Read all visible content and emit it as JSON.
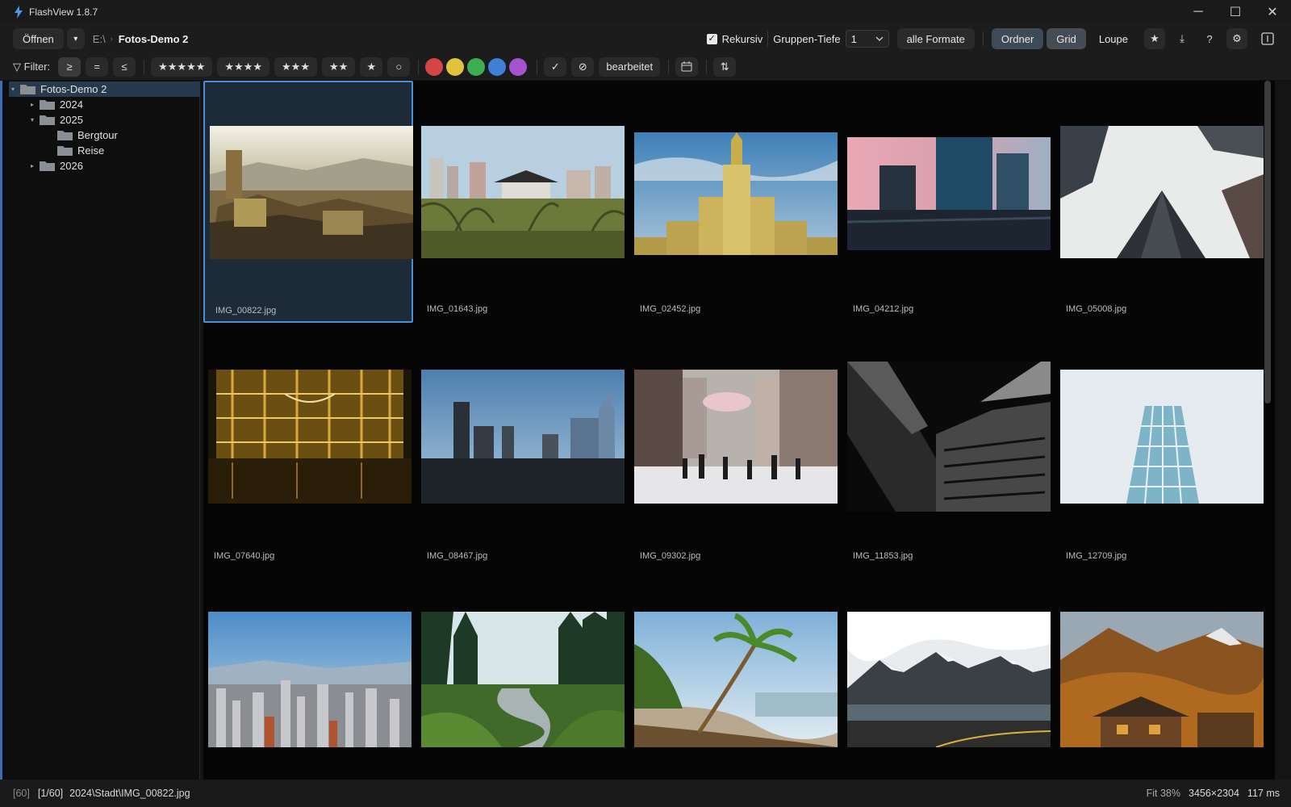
{
  "window": {
    "title": "FlashView 1.8.7",
    "controls": [
      "─",
      "☐",
      "✕"
    ]
  },
  "toolbar": {
    "open_label": "Öffnen",
    "open_dropdown": "▾",
    "path_root": "E:\\",
    "path_current": "Fotos-Demo 2",
    "recursive_label": "Rekursiv",
    "recursive_checked": "✓",
    "group_depth_label": "Gruppen-Tiefe",
    "group_depth_value": "1",
    "formats_label": "alle Formate",
    "view_modes": [
      "Ordner",
      "Grid",
      "Loupe"
    ],
    "active_view": "Grid",
    "icon_buttons": [
      {
        "name": "favorite-star-icon",
        "glyph": "★"
      },
      {
        "name": "download-icon",
        "glyph": "⤓"
      },
      {
        "name": "help-icon",
        "glyph": "?"
      },
      {
        "name": "gear-icon",
        "glyph": "⚙"
      },
      {
        "name": "info-panel-icon",
        "glyph": "▯"
      }
    ]
  },
  "filter": {
    "label": "Filter:",
    "label_icon": "▽",
    "comparators": [
      "≥",
      "=",
      "≤"
    ],
    "active_comparator": "≥",
    "ratings": [
      "★★★★★",
      "★★★★",
      "★★★",
      "★★",
      "★",
      "○"
    ],
    "colors": [
      {
        "name": "red",
        "hex": "#d64545"
      },
      {
        "name": "yellow",
        "hex": "#e0c23c"
      },
      {
        "name": "green",
        "hex": "#3fae52"
      },
      {
        "name": "blue",
        "hex": "#3f7fd6"
      },
      {
        "name": "purple",
        "hex": "#a552cf"
      }
    ],
    "flag_check": "✓",
    "flag_reject": "⊘",
    "edited_label": "bearbeitet",
    "calendar_icon": "▦",
    "sort_icon": "⇅"
  },
  "tree": [
    {
      "label": "Fotos-Demo 2",
      "level": 0,
      "expander": "▾",
      "selected": true
    },
    {
      "label": "2024",
      "level": 1,
      "expander": "▸"
    },
    {
      "label": "2025",
      "level": 1,
      "expander": "▾"
    },
    {
      "label": "Bergtour",
      "level": 2,
      "expander": ""
    },
    {
      "label": "Reise",
      "level": 2,
      "expander": ""
    },
    {
      "label": "2026",
      "level": 1,
      "expander": "▸"
    }
  ],
  "images": [
    {
      "file": "IMG_00822.jpg",
      "kind": "village",
      "selected": true
    },
    {
      "file": "IMG_01643.jpg",
      "kind": "pagoda"
    },
    {
      "file": "IMG_02452.jpg",
      "kind": "tower"
    },
    {
      "file": "IMG_04212.jpg",
      "kind": "towers-pink"
    },
    {
      "file": "IMG_05008.jpg",
      "kind": "skyward"
    },
    {
      "file": "IMG_07640.jpg",
      "kind": "atrium"
    },
    {
      "file": "IMG_08467.jpg",
      "kind": "skyline"
    },
    {
      "file": "IMG_09302.jpg",
      "kind": "street"
    },
    {
      "file": "IMG_11853.jpg",
      "kind": "bw-building"
    },
    {
      "file": "IMG_12709.jpg",
      "kind": "glass-tower"
    },
    {
      "file": "",
      "kind": "harbor-city"
    },
    {
      "file": "",
      "kind": "forest-stream"
    },
    {
      "file": "",
      "kind": "beach-palm"
    },
    {
      "file": "",
      "kind": "snow-mountains"
    },
    {
      "file": "",
      "kind": "autumn-chalet"
    }
  ],
  "status": {
    "count": "[60]",
    "position": "[1/60]",
    "path": "2024\\Stadt\\IMG_00822.jpg",
    "fit": "Fit 38%",
    "dimensions": "3456×2304",
    "load_time": "117 ms"
  },
  "colors": {
    "accent": "#4c8fd6",
    "selection_bg": "#1d2a38",
    "sidebar_accent": "#3d6db5"
  }
}
